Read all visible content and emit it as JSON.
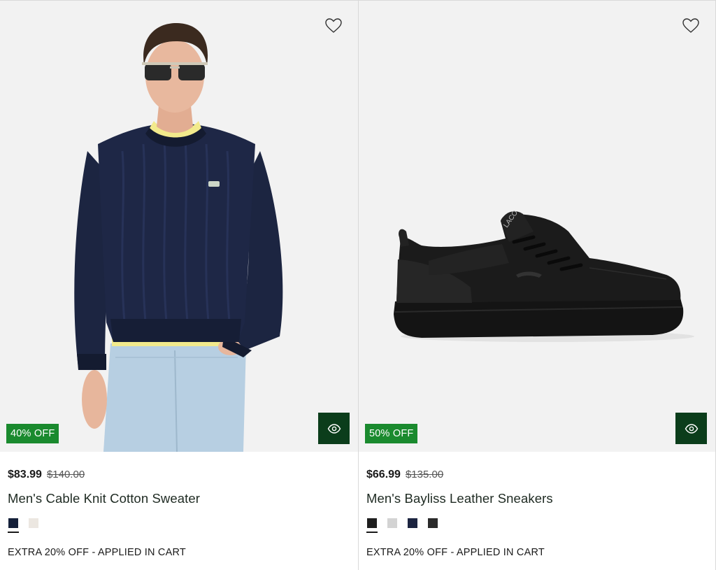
{
  "products": [
    {
      "name": "Men's Cable Knit Cotton Sweater",
      "price_current": "$83.99",
      "price_original": "$140.00",
      "discount_badge": "40% OFF",
      "promo": "EXTRA 20% OFF - APPLIED IN CART",
      "image": "model-wearing-navy-cable-knit-sweater",
      "swatches": [
        {
          "color": "#15203a",
          "selected": true
        },
        {
          "color": "#ece7e1",
          "selected": false
        }
      ]
    },
    {
      "name": "Men's Bayliss Leather Sneakers",
      "price_current": "$66.99",
      "price_original": "$135.00",
      "discount_badge": "50% OFF",
      "promo": "EXTRA 20% OFF - APPLIED IN CART",
      "image": "black-leather-sneaker",
      "swatches": [
        {
          "color": "#1e1e1e",
          "selected": true
        },
        {
          "color": "#d3d3d3",
          "selected": false
        },
        {
          "color": "#1c2440",
          "selected": false
        },
        {
          "color": "#2a2a2a",
          "selected": false
        }
      ]
    }
  ],
  "colors": {
    "badge_green": "#1a8a2e",
    "quickview_green": "#0b3d1b",
    "media_bg": "#f2f2f2"
  },
  "icons": {
    "wishlist": "heart-outline-icon",
    "quickview": "eye-icon"
  }
}
